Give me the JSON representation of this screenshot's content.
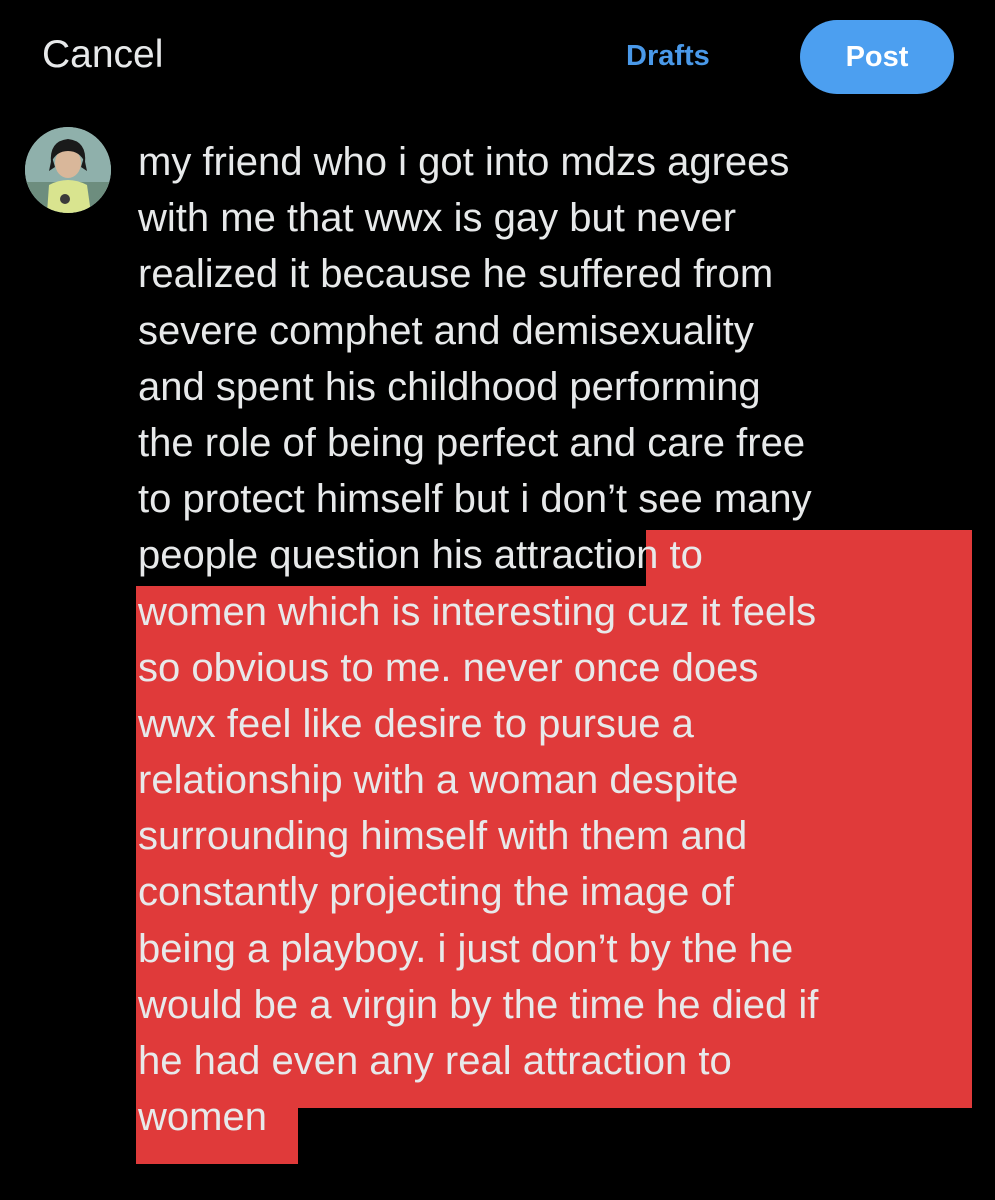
{
  "header": {
    "cancel_label": "Cancel",
    "drafts_label": "Drafts",
    "post_label": "Post"
  },
  "colors": {
    "background": "#000000",
    "text": "#e7e9ea",
    "accent": "#4c9ff0",
    "highlight": "#e03a3a"
  },
  "compose": {
    "lines": [
      "my friend who i got into mdzs agrees",
      "with me that wwx is gay but never",
      "realized it because he suffered from",
      "severe comphet and demisexuality",
      "and spent his childhood performing",
      "the role of being perfect and care free",
      "to protect himself but i don’t see many",
      "people question his attraction to",
      "women which is interesting cuz it feels",
      "so obvious to me. never once does",
      "wwx feel like desire to pursue a",
      "relationship with a woman despite",
      "surrounding himself with them and",
      "constantly projecting the image of",
      "being a playboy. i just don’t by the he",
      "would be a virgin by the time he died if",
      "he had even any real attraction to",
      "women"
    ]
  }
}
